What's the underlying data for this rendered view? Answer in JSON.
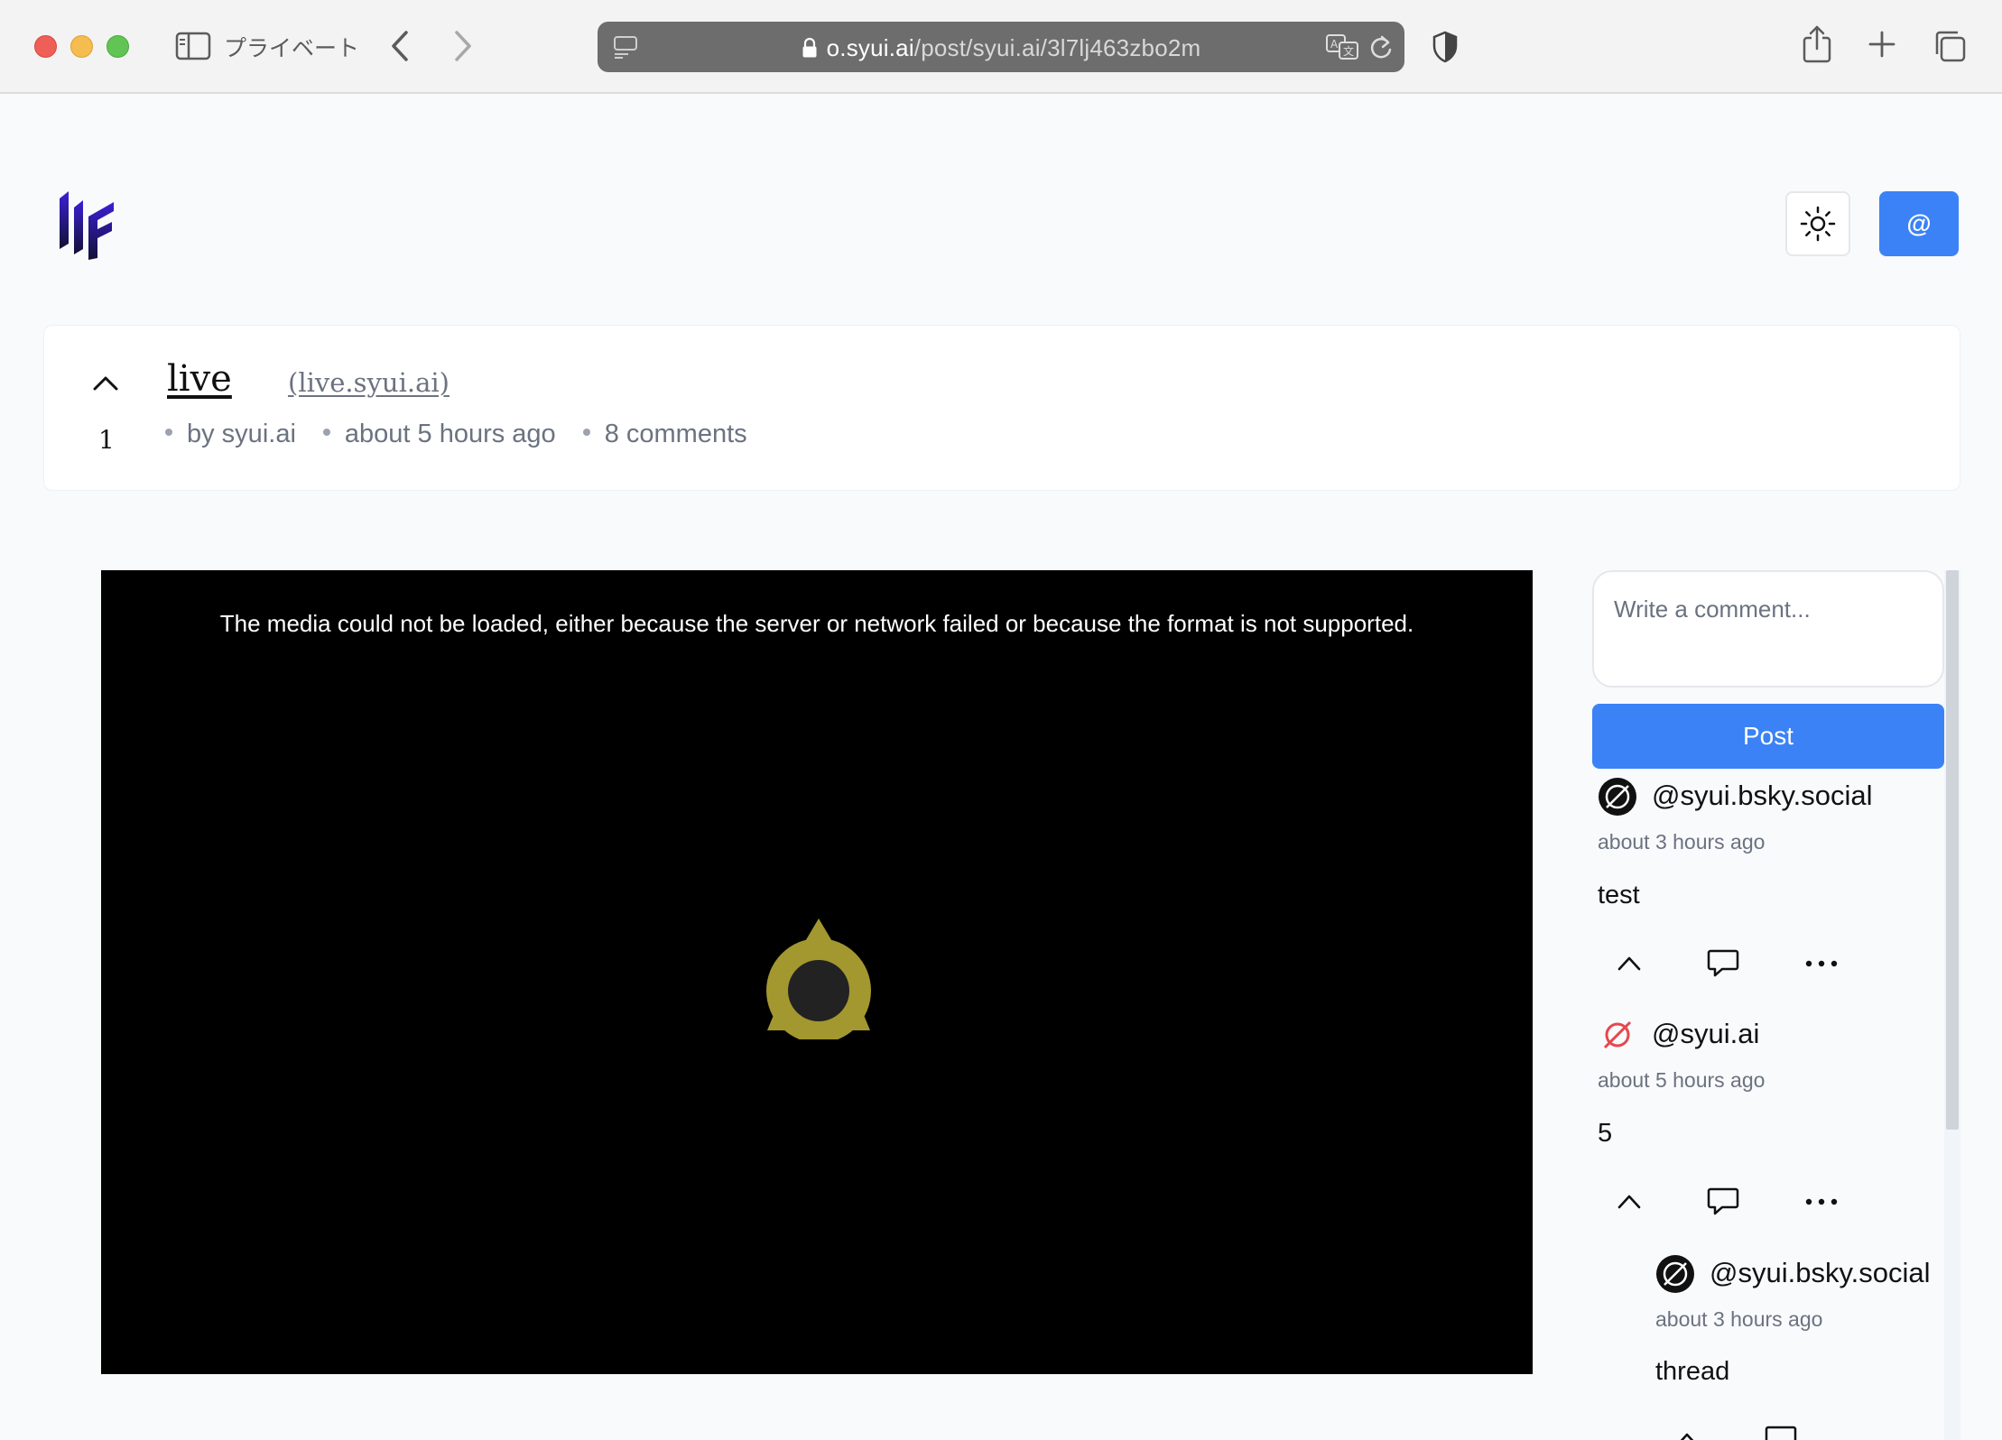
{
  "browser": {
    "private_label": "プライベート",
    "url_host": "o.syui.ai",
    "url_path": "/post/syui.ai/3l7lj463zbo2m"
  },
  "header": {
    "at_button_label": "@"
  },
  "post": {
    "score": "1",
    "title": "live",
    "domain": "(live.syui.ai)",
    "author": "by syui.ai",
    "time": "about 5 hours ago",
    "comments": "8 comments"
  },
  "media": {
    "error_text": "The media could not be loaded, either because the server or network failed or because the format is not supported."
  },
  "comment_box": {
    "placeholder": "Write a comment...",
    "post_label": "Post"
  },
  "comments": [
    {
      "handle": "@syui.bsky.social",
      "time": "about 3 hours ago",
      "body": "test",
      "avatar_color": "#111111"
    },
    {
      "handle": "@syui.ai",
      "time": "about 5 hours ago",
      "body": "5",
      "avatar_color": "#e5484d"
    },
    {
      "handle": "@syui.bsky.social",
      "time": "about 3 hours ago",
      "body": "thread",
      "avatar_color": "#111111"
    }
  ],
  "colors": {
    "accent": "#3b82f6",
    "media_icon": "#a3972f"
  }
}
